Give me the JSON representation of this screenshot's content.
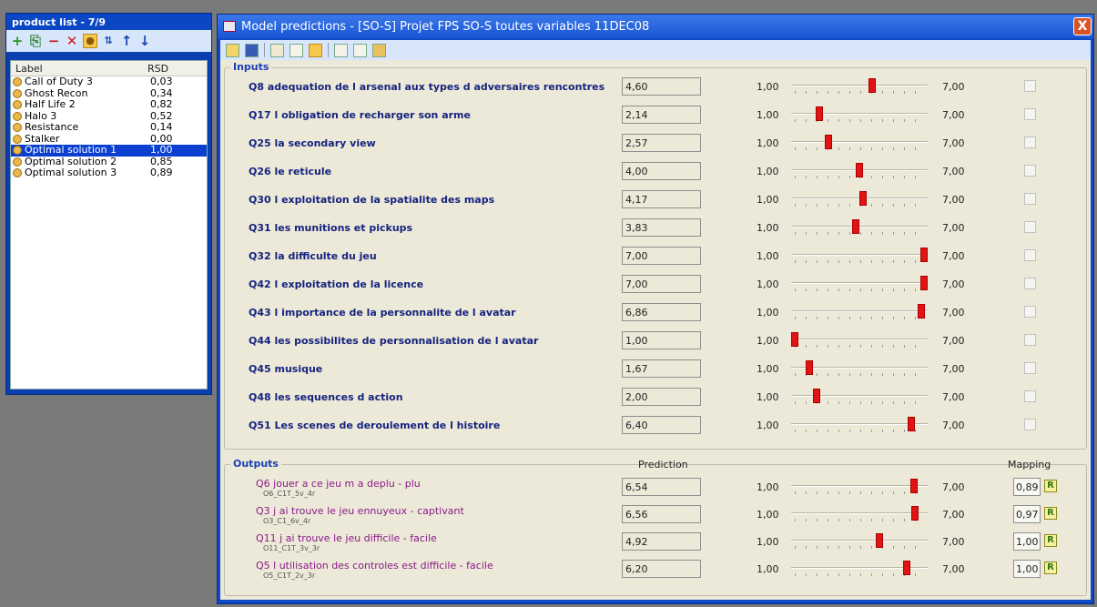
{
  "product_list": {
    "title": "product list - 7/9",
    "columns": [
      "Label",
      "RSD"
    ],
    "rows": [
      {
        "label": "Call of Duty 3",
        "rsd": "0,03"
      },
      {
        "label": "Ghost Recon",
        "rsd": "0,34"
      },
      {
        "label": "Half Life 2",
        "rsd": "0,82"
      },
      {
        "label": "Halo 3",
        "rsd": "0,52"
      },
      {
        "label": "Resistance",
        "rsd": "0,14"
      },
      {
        "label": "Stalker",
        "rsd": "0,00"
      },
      {
        "label": "Optimal solution 1",
        "rsd": "1,00",
        "selected": true
      },
      {
        "label": "Optimal solution 2",
        "rsd": "0,85"
      },
      {
        "label": "Optimal solution 3",
        "rsd": "0,89"
      }
    ],
    "toolbar_icons": [
      "add-icon",
      "copy-icon",
      "remove-icon",
      "delete-icon",
      "lock-icon",
      "sort-icon",
      "move-up-icon",
      "move-down-icon"
    ]
  },
  "model": {
    "title": "Model predictions - [SO-S] Projet FPS SO-S toutes variables 11DEC08",
    "close_label": "X",
    "toolbar_icons": [
      "open-icon",
      "save-icon",
      "run-icon",
      "document-icon",
      "bar-icon",
      "window-icon",
      "chart-icon",
      "tools-icon"
    ],
    "inputs_label": "Inputs",
    "outputs_label": "Outputs",
    "prediction_header": "Prediction",
    "mapping_header": "Mapping",
    "min": "1,00",
    "max": "7,00",
    "range": [
      1,
      7
    ],
    "inputs": [
      {
        "label": "Q8 adequation de l arsenal aux types d adversaires rencontres",
        "value": "4,60",
        "level": 4.6
      },
      {
        "label": "Q17 l obligation de recharger son arme",
        "value": "2,14",
        "level": 2.14
      },
      {
        "label": "Q25 la secondary view",
        "value": "2,57",
        "level": 2.57
      },
      {
        "label": "Q26 le reticule",
        "value": "4,00",
        "level": 4.0
      },
      {
        "label": "Q30 l exploitation de la spatialite des maps",
        "value": "4,17",
        "level": 4.17
      },
      {
        "label": "Q31 les munitions et pickups",
        "value": "3,83",
        "level": 3.83
      },
      {
        "label": "Q32 la difficulte du jeu",
        "value": "7,00",
        "level": 7.0
      },
      {
        "label": "Q42 l exploitation de la licence",
        "value": "7,00",
        "level": 7.0
      },
      {
        "label": "Q43 l importance de la personnalite de l avatar",
        "value": "6,86",
        "level": 6.86
      },
      {
        "label": "Q44 les possibilites de personnalisation de l avatar",
        "value": "1,00",
        "level": 1.0
      },
      {
        "label": "Q45 musique",
        "value": "1,67",
        "level": 1.67
      },
      {
        "label": "Q48 les sequences d action",
        "value": "2,00",
        "level": 2.0
      },
      {
        "label": "Q51 Les scenes de deroulement de l histoire",
        "value": "6,40",
        "level": 6.4
      }
    ],
    "outputs": [
      {
        "label": "Q6 jouer a ce jeu m a deplu - plu",
        "sub": "O6_C1T_5v_4r",
        "value": "6,54",
        "level": 6.54,
        "mapping": "0,89"
      },
      {
        "label": "Q3 j ai trouve le jeu ennuyeux - captivant",
        "sub": "O3_C1_6v_4r",
        "value": "6,56",
        "level": 6.56,
        "mapping": "0,97"
      },
      {
        "label": "Q11 j ai trouve le jeu difficile - facile",
        "sub": "O11_C1T_3v_3r",
        "value": "4,92",
        "level": 4.92,
        "mapping": "1,00"
      },
      {
        "label": "Q5 l utilisation des controles est difficile - facile",
        "sub": "O5_C1T_2v_3r",
        "value": "6,20",
        "level": 6.2,
        "mapping": "1,00"
      }
    ],
    "mapping_icon_label": "R"
  }
}
